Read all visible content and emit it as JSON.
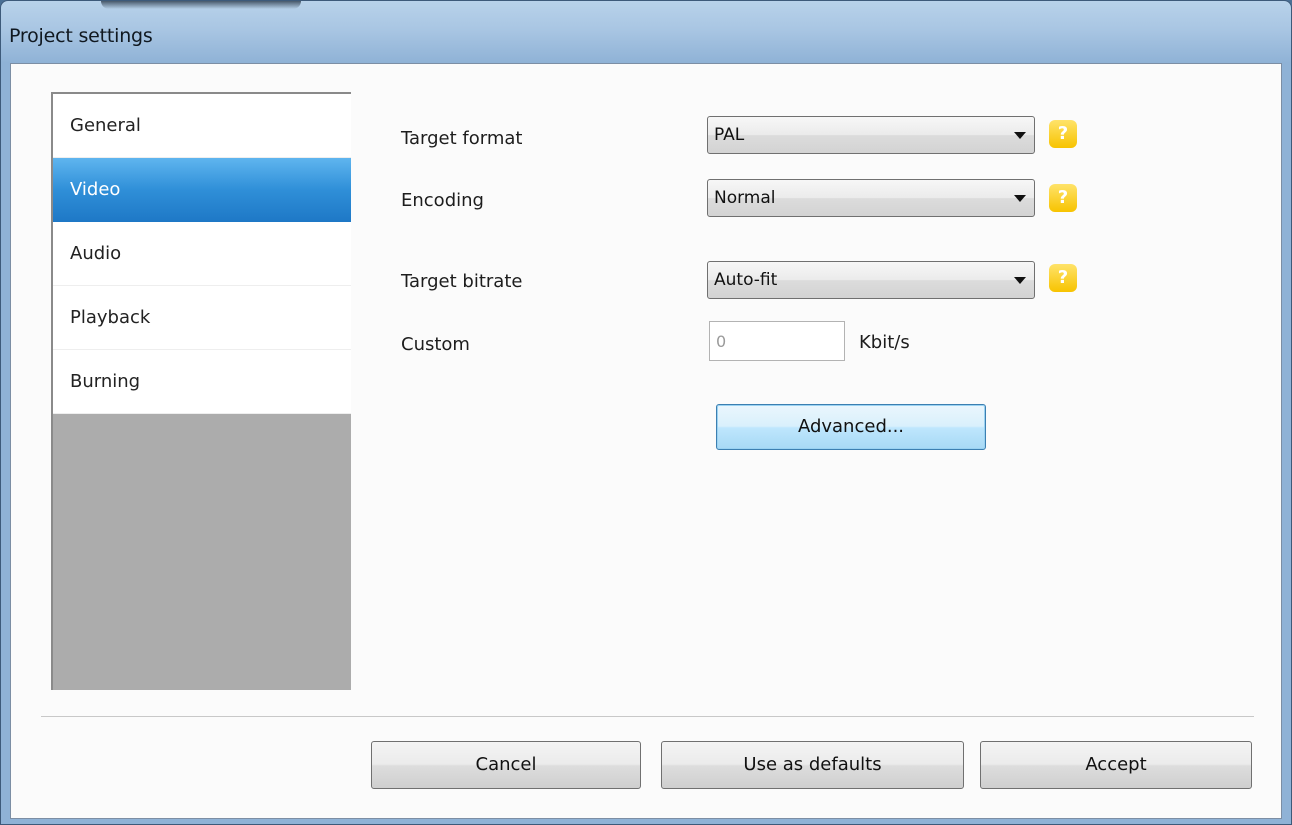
{
  "window": {
    "title": "Project settings"
  },
  "nav": {
    "items": [
      {
        "label": "General",
        "selected": false
      },
      {
        "label": "Video",
        "selected": true
      },
      {
        "label": "Audio",
        "selected": false
      },
      {
        "label": "Playback",
        "selected": false
      },
      {
        "label": "Burning",
        "selected": false
      }
    ]
  },
  "video": {
    "target_format": {
      "label": "Target format",
      "value": "PAL"
    },
    "encoding": {
      "label": "Encoding",
      "value": "Normal"
    },
    "target_bitrate": {
      "label": "Target bitrate",
      "value": "Auto-fit"
    },
    "custom": {
      "label": "Custom",
      "value": "0",
      "unit": "Kbit/s"
    },
    "advanced_button": "Advanced...",
    "help_icon_text": "?"
  },
  "footer": {
    "cancel": "Cancel",
    "use_as_defaults": "Use as defaults",
    "accept": "Accept"
  },
  "colors": {
    "selection_accent": "#2f8fd8",
    "help_badge": "#f7c300"
  }
}
